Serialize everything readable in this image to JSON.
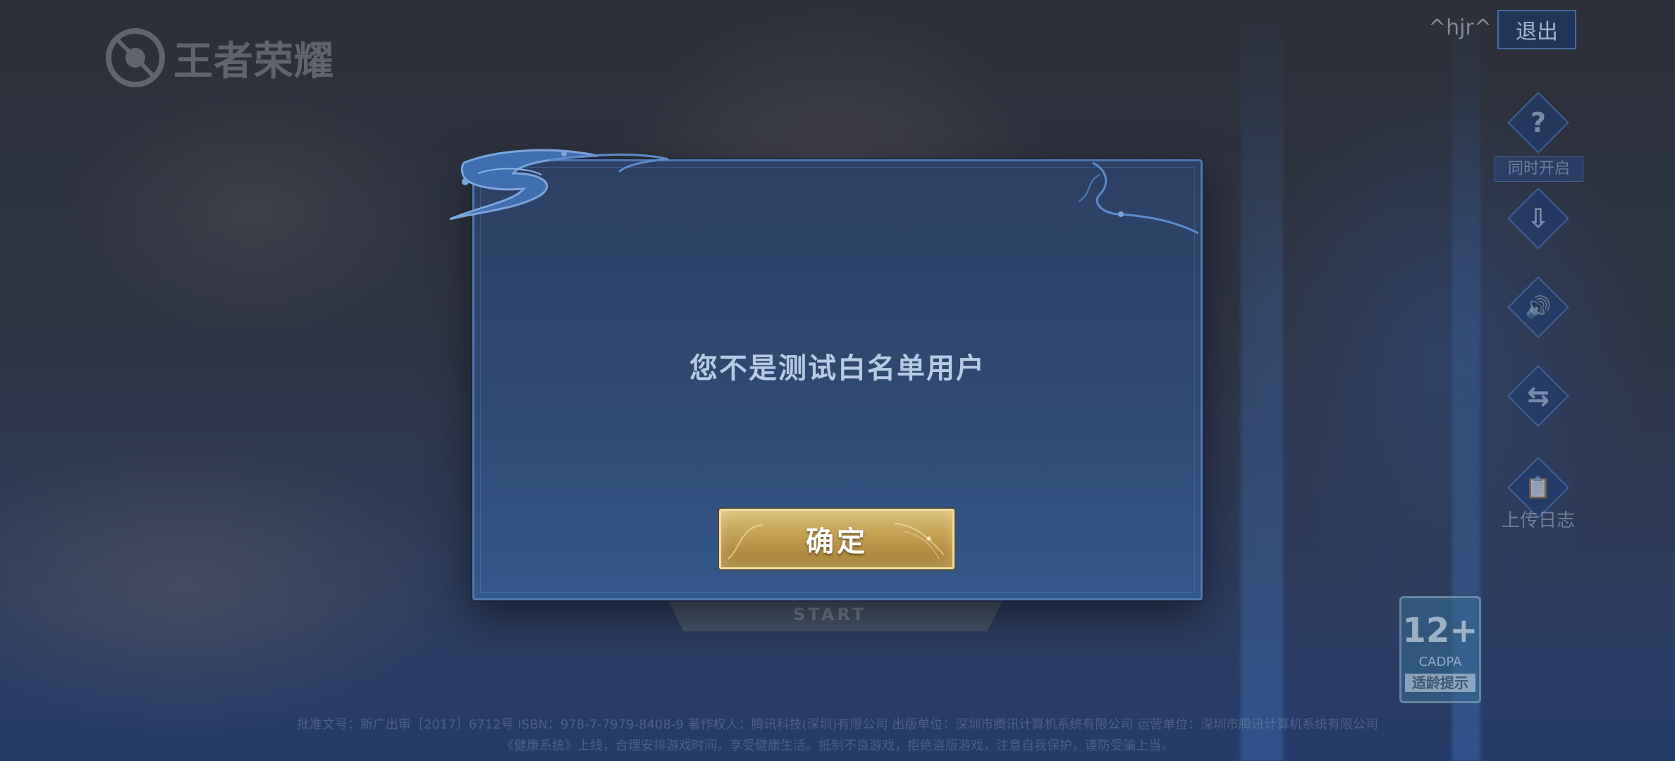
{
  "background": {
    "logo_text": "王者荣耀",
    "user": {
      "name": "^hjr^"
    },
    "exit_button": {
      "label": "退出"
    },
    "side_menu": [
      {
        "icon": "question-icon",
        "glyph": "?",
        "label": "同时开启"
      },
      {
        "icon": "download-icon",
        "glyph": "⇩",
        "label": ""
      },
      {
        "icon": "speaker-icon",
        "glyph": "🔊",
        "label": ""
      },
      {
        "icon": "switch-account-icon",
        "glyph": "⇆",
        "label": ""
      },
      {
        "icon": "clipboard-icon",
        "glyph": "📋",
        "label": "上传日志"
      }
    ],
    "age_rating": {
      "number": "12+",
      "org": "CADPA",
      "tip": "适龄提示"
    },
    "start_button": {
      "label": "START"
    },
    "legal_lines": [
      "批准文号：新广出审［2017］6712号 ISBN：978-7-7979-8408-9 著作权人：腾讯科技(深圳)有限公司 出版单位：深圳市腾讯计算机系统有限公司 运营单位：深圳市腾讯计算机系统有限公司",
      "《健康系统》上线，合理安排游戏时间，享受健康生活。抵制不良游戏，拒绝盗版游戏，注意自我保护，谨防受骗上当。"
    ]
  },
  "dialog": {
    "message": "您不是测试白名单用户",
    "confirm_label": "确定"
  },
  "colors": {
    "dialog_bg": "#2e4a73",
    "dialog_border": "#4f78b0",
    "message_text": "#b7cbe6",
    "button_gold": "#c7a65a"
  }
}
